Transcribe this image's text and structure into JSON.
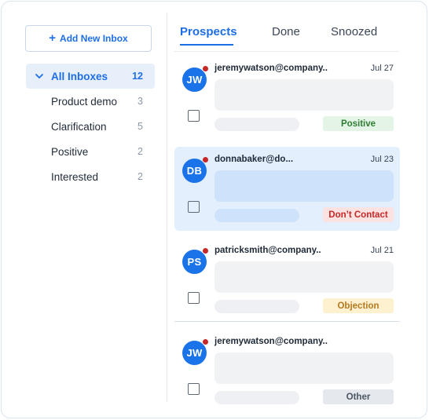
{
  "sidebar": {
    "add_inbox_label": "Add New Inbox",
    "inboxes": [
      {
        "label": "All Inboxes",
        "count": "12",
        "active": true
      },
      {
        "label": "Product demo",
        "count": "3"
      },
      {
        "label": "Clarification",
        "count": "5"
      },
      {
        "label": "Positive",
        "count": "2"
      },
      {
        "label": "Interested",
        "count": "2"
      }
    ]
  },
  "tabs": [
    "Prospects",
    "Done",
    "Snoozed"
  ],
  "active_tab": "Prospects",
  "conversations": [
    {
      "initials": "JW",
      "email": "jeremywatson@company..",
      "date": "Jul 27",
      "tag": "Positive",
      "tag_bg": "#e4f5e8",
      "tag_color": "#2e7d32",
      "unread": true,
      "selected": false
    },
    {
      "initials": "DB",
      "email": "donnabaker@do...",
      "date": "Jul 23",
      "tag": "Don’t Contact",
      "tag_bg": "#fde2e2",
      "tag_color": "#c62828",
      "unread": true,
      "selected": true
    },
    {
      "initials": "PS",
      "email": "patricksmith@company..",
      "date": "Jul 21",
      "tag": "Objection",
      "tag_bg": "#fdf1cf",
      "tag_color": "#b7791f",
      "unread": true,
      "selected": false
    },
    {
      "initials": "JW",
      "email": "jeremywatson@company..",
      "date": "",
      "tag": "Other",
      "tag_bg": "#e5e8ec",
      "tag_color": "#4b5563",
      "unread": true,
      "selected": false
    }
  ],
  "colors": {
    "accent": "#1e6ee8",
    "avatar": "#1a73e8",
    "unread_dot": "#c62828"
  }
}
